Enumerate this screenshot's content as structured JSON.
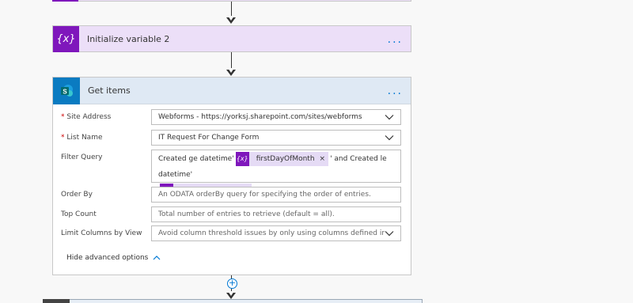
{
  "colors": {
    "variable_accent": "#7f17bc",
    "variable_bg": "#ecdff8",
    "sharepoint_accent": "#0a7bc1",
    "sharepoint_bg": "#dfe9f4",
    "link_blue": "#0078d4"
  },
  "steps": [
    {
      "title": "Initialize variable 2",
      "icon": "variable-icon",
      "icon_text": "{x}",
      "more": "..."
    },
    {
      "title": "Get items",
      "icon": "sharepoint-icon",
      "more": "..."
    }
  ],
  "get_items": {
    "site_address": {
      "label": "* Site Address",
      "value": "Webforms - https://yorksj.sharepoint.com/sites/webforms"
    },
    "list_name": {
      "label": "* List Name",
      "value": "IT Request For Change Form"
    },
    "filter_query": {
      "label": "Filter Query",
      "text_before": "Created ge datetime'",
      "token1": "firstDayOfMonth",
      "text_middle": "' and Created le datetime'",
      "token2": "lastDayOfMonth",
      "text_after": "'",
      "token_icon_text": "{x}",
      "remove": "×"
    },
    "order_by": {
      "label": "Order By",
      "placeholder": "An ODATA orderBy query for specifying the order of entries."
    },
    "top_count": {
      "label": "Top Count",
      "placeholder": "Total number of entries to retrieve (default = all)."
    },
    "limit_columns": {
      "label": "Limit Columns by View",
      "placeholder": "Avoid column threshold issues by only using columns defined in a view"
    },
    "advanced_toggle": "Hide advanced options"
  },
  "add_step": "+"
}
